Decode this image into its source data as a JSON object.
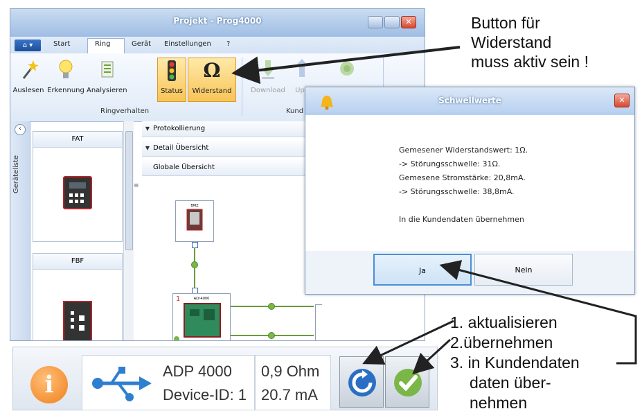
{
  "window": {
    "title": "Projekt - Prog4000",
    "tabs": [
      "Start",
      "Ring",
      "Gerät",
      "Einstellungen",
      "?"
    ],
    "active_tab": "Ring"
  },
  "ribbon": {
    "buttons": [
      "Auslesen",
      "Erkennung",
      "Analysieren",
      "Status",
      "Widerstand",
      "Download",
      "Up"
    ],
    "group_ring": "Ringverhalten",
    "group_kunde": "Kund"
  },
  "sidebar": {
    "label": "Geräteliste",
    "cards": [
      "FAT",
      "FBF"
    ]
  },
  "panels": {
    "rows": [
      "Protokollierung",
      "Detail Übersicht",
      "Globale Übersicht"
    ]
  },
  "diagram": {
    "bmz_label": "BMZ",
    "adp_label": "ALY-4000",
    "ring_number": "1"
  },
  "dialog": {
    "title": "Schwellwerte",
    "line1": "Gemesener Widerstandswert:  1Ω.",
    "line2": "-> Störungsschwelle: 31Ω.",
    "line3": "Gemesene Stromstärke: 20,8mA.",
    "line4": "-> Störungsschwelle: 38,8mA.",
    "line5": "In die Kundendaten übernehmen",
    "yes": "Ja",
    "no": "Nein"
  },
  "statusbar": {
    "device": "ADP 4000",
    "device_id": "Device-ID: 1",
    "resistance": "0,9 Ohm",
    "current": "20.7 mA"
  },
  "annotations": {
    "top_line1": "Button für",
    "top_line2": "Widerstand",
    "top_line3": "muss aktiv sein !",
    "step1": "1. aktualisieren",
    "step2": "2.übernehmen",
    "step3": "3. in Kundendaten",
    "step3b": "daten über-",
    "step3c": "nehmen"
  },
  "colors": {
    "accent": "#4b8ed4",
    "active_button": "#f8c458",
    "info_icon": "#ef7f1a",
    "ok_green": "#7ab648"
  }
}
